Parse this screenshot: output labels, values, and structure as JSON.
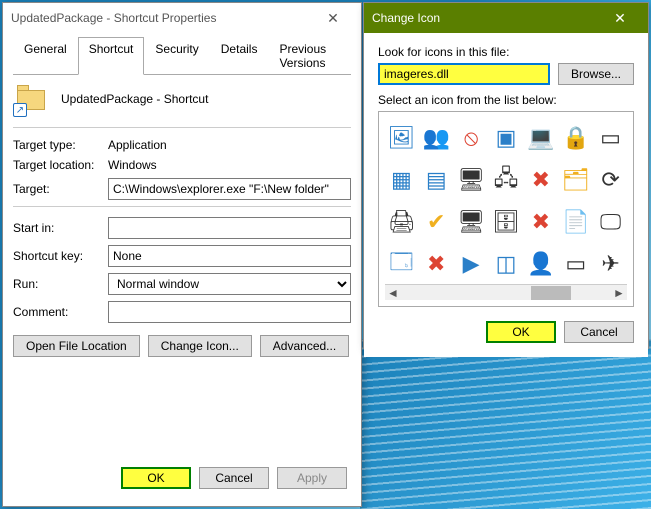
{
  "properties": {
    "title": "UpdatedPackage - Shortcut Properties",
    "tabs": [
      "General",
      "Shortcut",
      "Security",
      "Details",
      "Previous Versions"
    ],
    "active_tab": 1,
    "shortcut_name": "UpdatedPackage - Shortcut",
    "rows": {
      "target_type_label": "Target type:",
      "target_type": "Application",
      "target_location_label": "Target location:",
      "target_location": "Windows",
      "target_label": "Target:",
      "target": "C:\\Windows\\explorer.exe \"F:\\New folder\"",
      "start_in_label": "Start in:",
      "start_in": "",
      "shortcut_key_label": "Shortcut key:",
      "shortcut_key": "None",
      "run_label": "Run:",
      "run": "Normal window",
      "comment_label": "Comment:",
      "comment": ""
    },
    "buttons": {
      "open_file_location": "Open File Location",
      "change_icon": "Change Icon...",
      "advanced": "Advanced...",
      "ok": "OK",
      "cancel": "Cancel",
      "apply": "Apply"
    }
  },
  "change_icon": {
    "title": "Change Icon",
    "look_label": "Look for icons in this file:",
    "path": "imageres.dll",
    "browse": "Browse...",
    "select_label": "Select an icon from the list below:",
    "ok": "OK",
    "cancel": "Cancel",
    "icons": [
      {
        "g": "🖼",
        "c": ""
      },
      {
        "g": "👥",
        "c": ""
      },
      {
        "g": "⦸",
        "c": "red"
      },
      {
        "g": "▣",
        "c": ""
      },
      {
        "g": "💻",
        "c": ""
      },
      {
        "g": "🔒",
        "c": "yellow"
      },
      {
        "g": "▭",
        "c": "dark"
      },
      {
        "g": "▦",
        "c": ""
      },
      {
        "g": "▤",
        "c": ""
      },
      {
        "g": "🖥",
        "c": "dark"
      },
      {
        "g": "🖧",
        "c": "dark"
      },
      {
        "g": "✖",
        "c": "red"
      },
      {
        "g": "🗂",
        "c": "yellow"
      },
      {
        "g": "⟳",
        "c": "dark"
      },
      {
        "g": "🖨",
        "c": "dark"
      },
      {
        "g": "✔",
        "c": "yellow"
      },
      {
        "g": "🖥",
        "c": "dark"
      },
      {
        "g": "🗄",
        "c": "dark"
      },
      {
        "g": "✖",
        "c": "red"
      },
      {
        "g": "📄",
        "c": ""
      },
      {
        "g": "🖵",
        "c": "dark"
      },
      {
        "g": "🗔",
        "c": ""
      },
      {
        "g": "✖",
        "c": "red"
      },
      {
        "g": "▶",
        "c": ""
      },
      {
        "g": "◫",
        "c": ""
      },
      {
        "g": "👤",
        "c": ""
      },
      {
        "g": "▭",
        "c": "dark"
      },
      {
        "g": "✈",
        "c": "dark"
      }
    ]
  }
}
